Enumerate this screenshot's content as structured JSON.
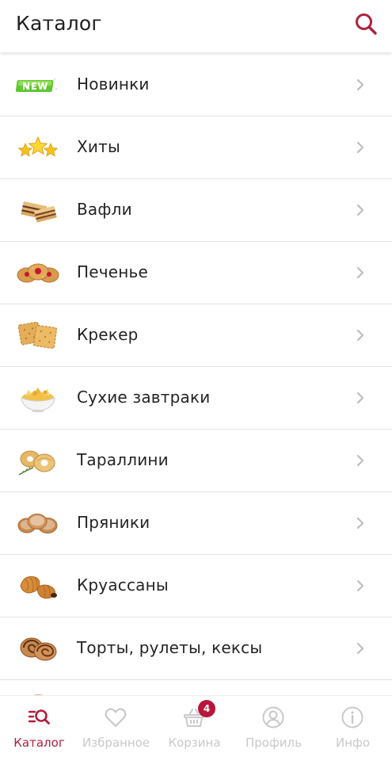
{
  "header": {
    "title": "Каталог"
  },
  "catalog": {
    "items": [
      {
        "label": "Новинки",
        "icon": "new-badge-icon"
      },
      {
        "label": "Хиты",
        "icon": "stars-icon"
      },
      {
        "label": "Вафли",
        "icon": "wafer-icon"
      },
      {
        "label": "Печенье",
        "icon": "cookie-icon"
      },
      {
        "label": "Крекер",
        "icon": "cracker-icon"
      },
      {
        "label": "Сухие завтраки",
        "icon": "cereal-bowl-icon"
      },
      {
        "label": "Тараллини",
        "icon": "taralli-icon"
      },
      {
        "label": "Пряники",
        "icon": "gingerbread-icon"
      },
      {
        "label": "Круассаны",
        "icon": "croissant-icon"
      },
      {
        "label": "Торты, рулеты, кексы",
        "icon": "cake-roll-icon"
      }
    ]
  },
  "tabbar": {
    "tabs": [
      {
        "label": "Каталог",
        "icon": "catalog-search-icon",
        "active": true
      },
      {
        "label": "Избранное",
        "icon": "heart-icon",
        "active": false
      },
      {
        "label": "Корзина",
        "icon": "basket-icon",
        "active": false
      },
      {
        "label": "Профиль",
        "icon": "profile-icon",
        "active": false
      },
      {
        "label": "Инфо",
        "icon": "info-icon",
        "active": false
      }
    ],
    "cart_badge": "4"
  },
  "colors": {
    "accent": "#b0203e",
    "badge": "#b8163a",
    "inactive": "#c9c9c9",
    "divider": "#e3e3e3"
  }
}
